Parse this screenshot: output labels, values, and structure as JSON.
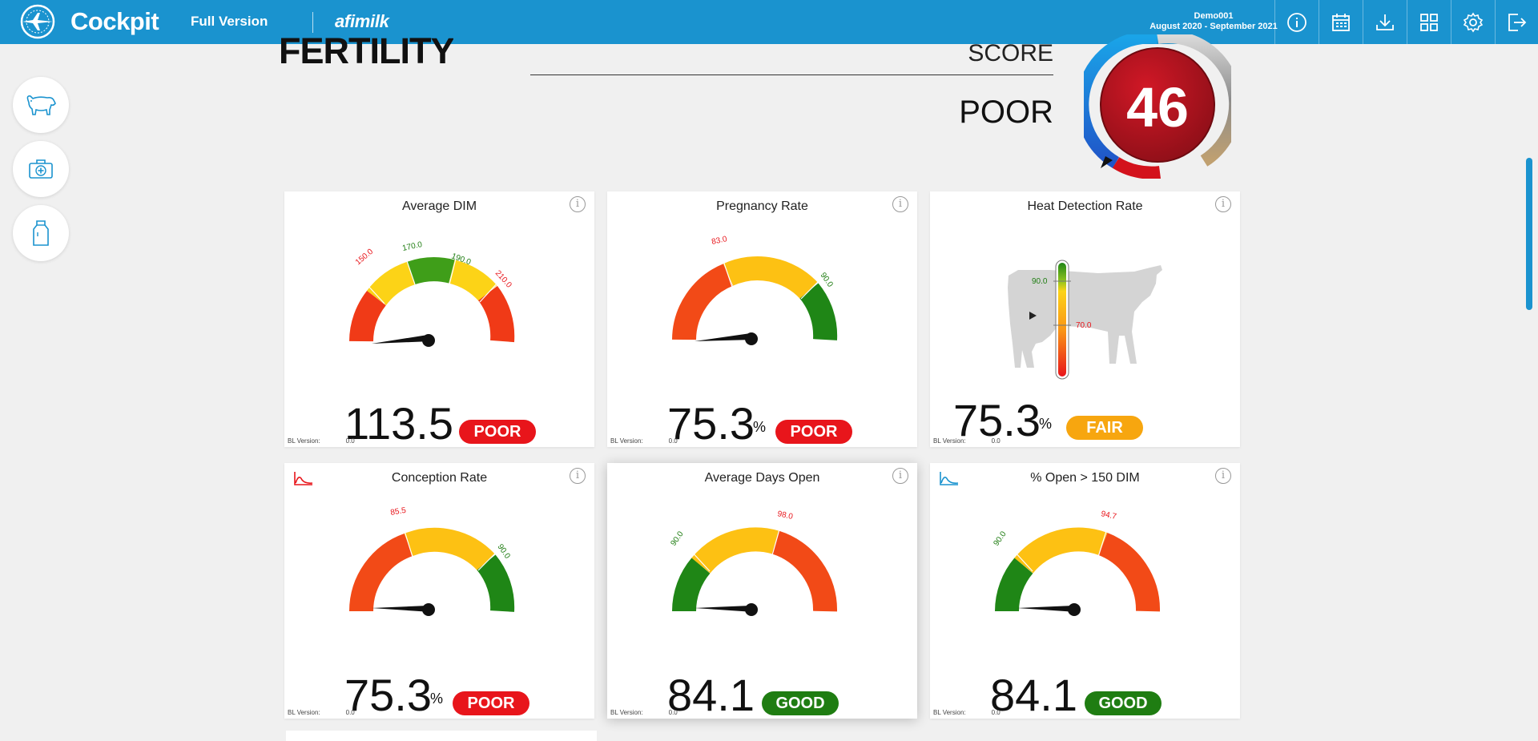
{
  "header": {
    "brand": "Cockpit",
    "version": "Full Version",
    "partner": "afimilk",
    "farm_name": "Demo001",
    "date_range": "August 2020 - September 2021",
    "icons": [
      "info-icon",
      "calendar-icon",
      "download-icon",
      "grid-icon",
      "gear-icon",
      "logout-icon"
    ]
  },
  "sidebar": {
    "items": [
      {
        "icon": "cow-icon"
      },
      {
        "icon": "medical-kit-icon"
      },
      {
        "icon": "milk-bottle-icon"
      }
    ]
  },
  "section": {
    "title": "FERTILITY",
    "score_label": "SCORE",
    "score_status": "POOR",
    "score_value": "46"
  },
  "colors": {
    "header": "#1a93cf",
    "poor": "#e8151b",
    "fair": "#f7a60f",
    "good": "#1f7d12",
    "score_disc": "#b3141f"
  },
  "cards": [
    {
      "title": "Average DIM",
      "value": "113.5",
      "unit": "",
      "status": "POOR",
      "bl_label": "BL Version:",
      "bl_value": "0.0",
      "tick_labels": [
        "150.0",
        "170.0",
        "190.0",
        "210.0"
      ]
    },
    {
      "title": "Pregnancy Rate",
      "value": "75.3",
      "unit": "%",
      "status": "POOR",
      "bl_label": "BL Version:",
      "bl_value": "0.0",
      "tick_labels": [
        "83.0",
        "90.0"
      ]
    },
    {
      "title": "Heat Detection Rate",
      "value": "75.3",
      "unit": "%",
      "status": "FAIR",
      "bl_label": "BL Version:",
      "bl_value": "0.0",
      "tick_labels": [
        "90.0",
        "70.0"
      ]
    },
    {
      "title": "Conception Rate",
      "value": "75.3",
      "unit": "%",
      "status": "POOR",
      "bl_label": "BL Version:",
      "bl_value": "0.0",
      "tick_labels": [
        "85.5",
        "90.0"
      ]
    },
    {
      "title": "Average Days Open",
      "value": "84.1",
      "unit": "",
      "status": "GOOD",
      "bl_label": "BL Version:",
      "bl_value": "0.0",
      "tick_labels": [
        "90.0",
        "98.0"
      ]
    },
    {
      "title": "% Open > 150 DIM",
      "value": "84.1",
      "unit": "",
      "status": "GOOD",
      "bl_label": "BL Version:",
      "bl_value": "0.0",
      "tick_labels": [
        "90.0",
        "94.7"
      ]
    }
  ]
}
